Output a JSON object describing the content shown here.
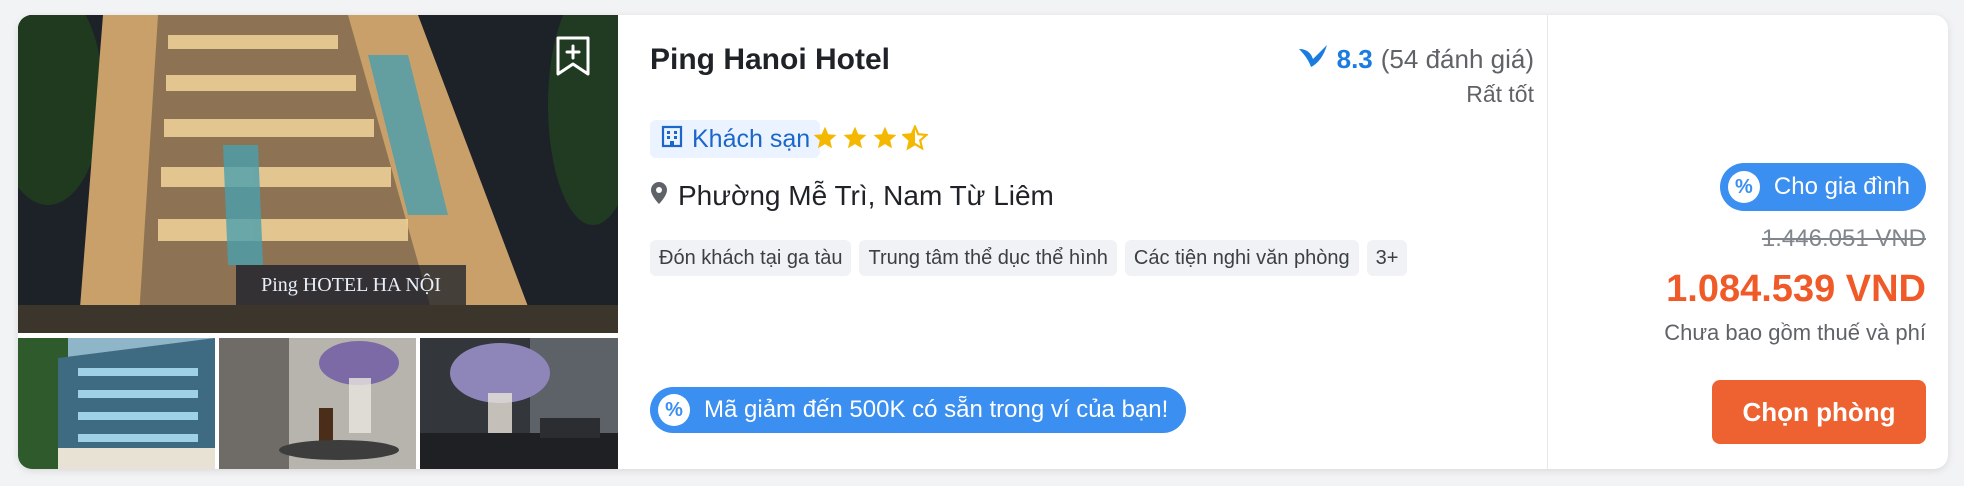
{
  "hotel": {
    "name": "Ping Hanoi Hotel",
    "type_label": "Khách sạn",
    "star_rating": 3.5,
    "location": "Phường Mễ Trì, Nam Từ Liêm"
  },
  "rating": {
    "score": "8.3",
    "review_count": "(54 đánh giá)",
    "label": "Rất tốt"
  },
  "facilities": [
    "Đón khách tại ga tàu",
    "Trung tâm thể dục thể hình",
    "Các tiện nghi văn phòng",
    "3+"
  ],
  "promo": {
    "text": "Mã giảm đến 500K có sẵn trong ví của bạn!",
    "icon": "percent-icon"
  },
  "photo_sign": "Ping HOTEL HA NỘI",
  "price": {
    "badge": "Cho gia đình",
    "original": "1.446.051 VND",
    "discounted": "1.084.539 VND",
    "note": "Chưa bao gồm thuế và phí"
  },
  "actions": {
    "choose_room": "Chọn phòng"
  },
  "icons": {
    "bookmark": "bookmark-add-icon",
    "rating": "bird-icon",
    "hotel_type": "building-icon",
    "location": "location-pin-icon",
    "star": "star-icon"
  },
  "colors": {
    "accent_blue": "#3a8ff0",
    "rating_blue": "#1b7ce0",
    "price_orange": "#f05a28",
    "button_orange": "#ee6131",
    "star_gold": "#f5b800"
  }
}
